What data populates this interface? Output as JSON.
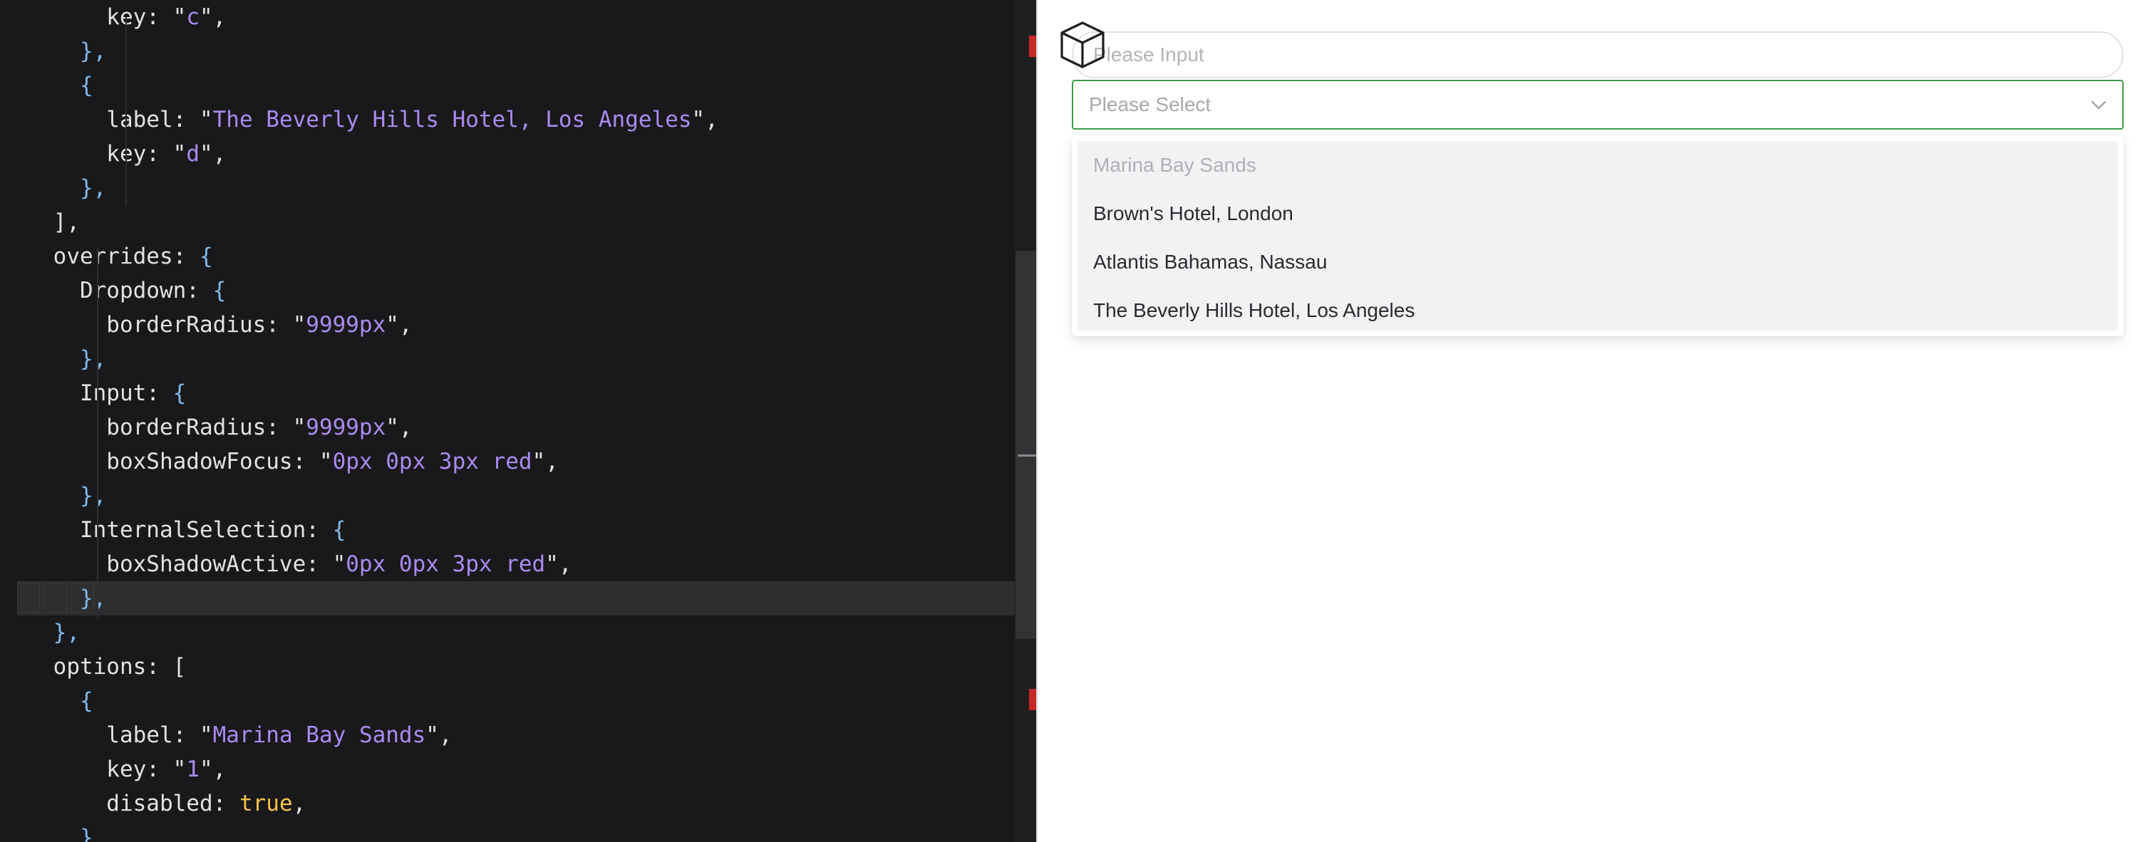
{
  "editor": {
    "lines": [
      [
        {
          "t": "        key: ",
          "c": "p"
        },
        {
          "t": "\"",
          "c": "p"
        },
        {
          "t": "c",
          "c": "s"
        },
        {
          "t": "\",",
          "c": "p"
        }
      ],
      [
        {
          "t": "      },",
          "c": "b"
        }
      ],
      [
        {
          "t": "      {",
          "c": "b"
        }
      ],
      [
        {
          "t": "        label: ",
          "c": "p"
        },
        {
          "t": "\"",
          "c": "p"
        },
        {
          "t": "The Beverly Hills Hotel, Los Angeles",
          "c": "s"
        },
        {
          "t": "\",",
          "c": "p"
        }
      ],
      [
        {
          "t": "        key: ",
          "c": "p"
        },
        {
          "t": "\"",
          "c": "p"
        },
        {
          "t": "d",
          "c": "s"
        },
        {
          "t": "\",",
          "c": "p"
        }
      ],
      [
        {
          "t": "      },",
          "c": "b"
        }
      ],
      [
        {
          "t": "    ],",
          "c": "p"
        }
      ],
      [
        {
          "t": "    overrides: ",
          "c": "p"
        },
        {
          "t": "{",
          "c": "b"
        }
      ],
      [
        {
          "t": "      Dropdown: ",
          "c": "p"
        },
        {
          "t": "{",
          "c": "b"
        }
      ],
      [
        {
          "t": "        borderRadius: ",
          "c": "p"
        },
        {
          "t": "\"",
          "c": "p"
        },
        {
          "t": "9999px",
          "c": "s"
        },
        {
          "t": "\",",
          "c": "p"
        }
      ],
      [
        {
          "t": "      },",
          "c": "b"
        }
      ],
      [
        {
          "t": "      Input: ",
          "c": "p"
        },
        {
          "t": "{",
          "c": "b"
        }
      ],
      [
        {
          "t": "        borderRadius: ",
          "c": "p"
        },
        {
          "t": "\"",
          "c": "p"
        },
        {
          "t": "9999px",
          "c": "s"
        },
        {
          "t": "\",",
          "c": "p"
        }
      ],
      [
        {
          "t": "        boxShadowFocus: ",
          "c": "p"
        },
        {
          "t": "\"",
          "c": "p"
        },
        {
          "t": "0px 0px 3px red",
          "c": "s"
        },
        {
          "t": "\",",
          "c": "p"
        }
      ],
      [
        {
          "t": "      },",
          "c": "b"
        }
      ],
      [
        {
          "t": "      InternalSelection: ",
          "c": "p"
        },
        {
          "t": "{",
          "c": "b"
        }
      ],
      [
        {
          "t": "        boxShadowActive: ",
          "c": "p"
        },
        {
          "t": "\"",
          "c": "p"
        },
        {
          "t": "0px 0px 3px red",
          "c": "s"
        },
        {
          "t": "\",",
          "c": "p"
        }
      ],
      [
        {
          "t": "      },",
          "c": "b"
        }
      ],
      [
        {
          "t": "    },",
          "c": "b"
        }
      ],
      [
        {
          "t": "    options: [",
          "c": "p"
        }
      ],
      [
        {
          "t": "      {",
          "c": "b"
        }
      ],
      [
        {
          "t": "        label: ",
          "c": "p"
        },
        {
          "t": "\"",
          "c": "p"
        },
        {
          "t": "Marina Bay Sands",
          "c": "s"
        },
        {
          "t": "\",",
          "c": "p"
        }
      ],
      [
        {
          "t": "        key: ",
          "c": "p"
        },
        {
          "t": "\"",
          "c": "p"
        },
        {
          "t": "1",
          "c": "s"
        },
        {
          "t": "\",",
          "c": "p"
        }
      ],
      [
        {
          "t": "        disabled: ",
          "c": "p"
        },
        {
          "t": "true",
          "c": "k"
        },
        {
          "t": ",",
          "c": "p"
        }
      ],
      [
        {
          "t": "      }",
          "c": "b"
        }
      ]
    ],
    "highlighted_line_index": 17
  },
  "preview": {
    "logo_icon": "cube-icon",
    "input": {
      "placeholder": "Please Input",
      "value": ""
    },
    "select": {
      "placeholder": "Please Select",
      "arrow_icon": "chevron-down-icon"
    },
    "dropdown": {
      "options": [
        {
          "label": "Marina Bay Sands",
          "disabled": true
        },
        {
          "label": "Brown's Hotel, London",
          "disabled": false
        },
        {
          "label": "Atlantis Bahamas, Nassau",
          "disabled": false
        },
        {
          "label": "The Beverly Hills Hotel, Los Angeles",
          "disabled": false
        }
      ]
    }
  },
  "colors": {
    "editor_bg": "#19191b",
    "string": "#a98bf0",
    "brace": "#7fb8e8",
    "keyword": "#f5c24a",
    "select_border_active": "#3c9a4a"
  }
}
